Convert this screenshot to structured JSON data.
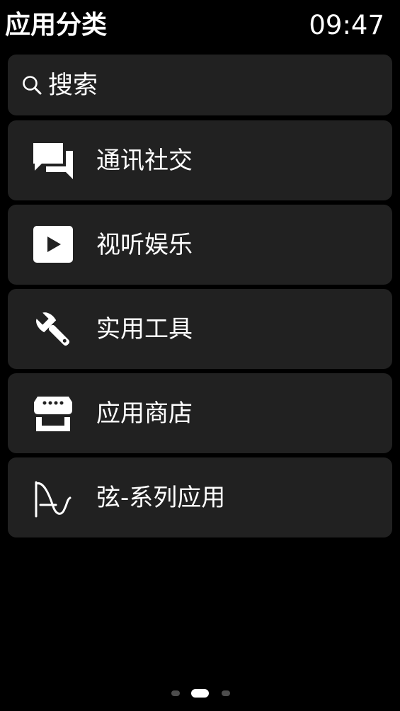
{
  "header": {
    "title": "应用分类",
    "time": "09:47"
  },
  "search": {
    "label": "搜索",
    "icon": "search-icon"
  },
  "categories": [
    {
      "label": "通讯社交",
      "icon": "chat-bubbles-icon"
    },
    {
      "label": "视听娱乐",
      "icon": "play-icon"
    },
    {
      "label": "实用工具",
      "icon": "wrench-icon"
    },
    {
      "label": "应用商店",
      "icon": "store-icon"
    },
    {
      "label": "弦-系列应用",
      "icon": "xian-logo-icon"
    }
  ],
  "pager": {
    "count": 3,
    "active_index": 1
  },
  "colors": {
    "background": "#000000",
    "card": "#212121",
    "text": "#ffffff",
    "dot_inactive": "#4d4d4d",
    "dot_active": "#ffffff"
  }
}
